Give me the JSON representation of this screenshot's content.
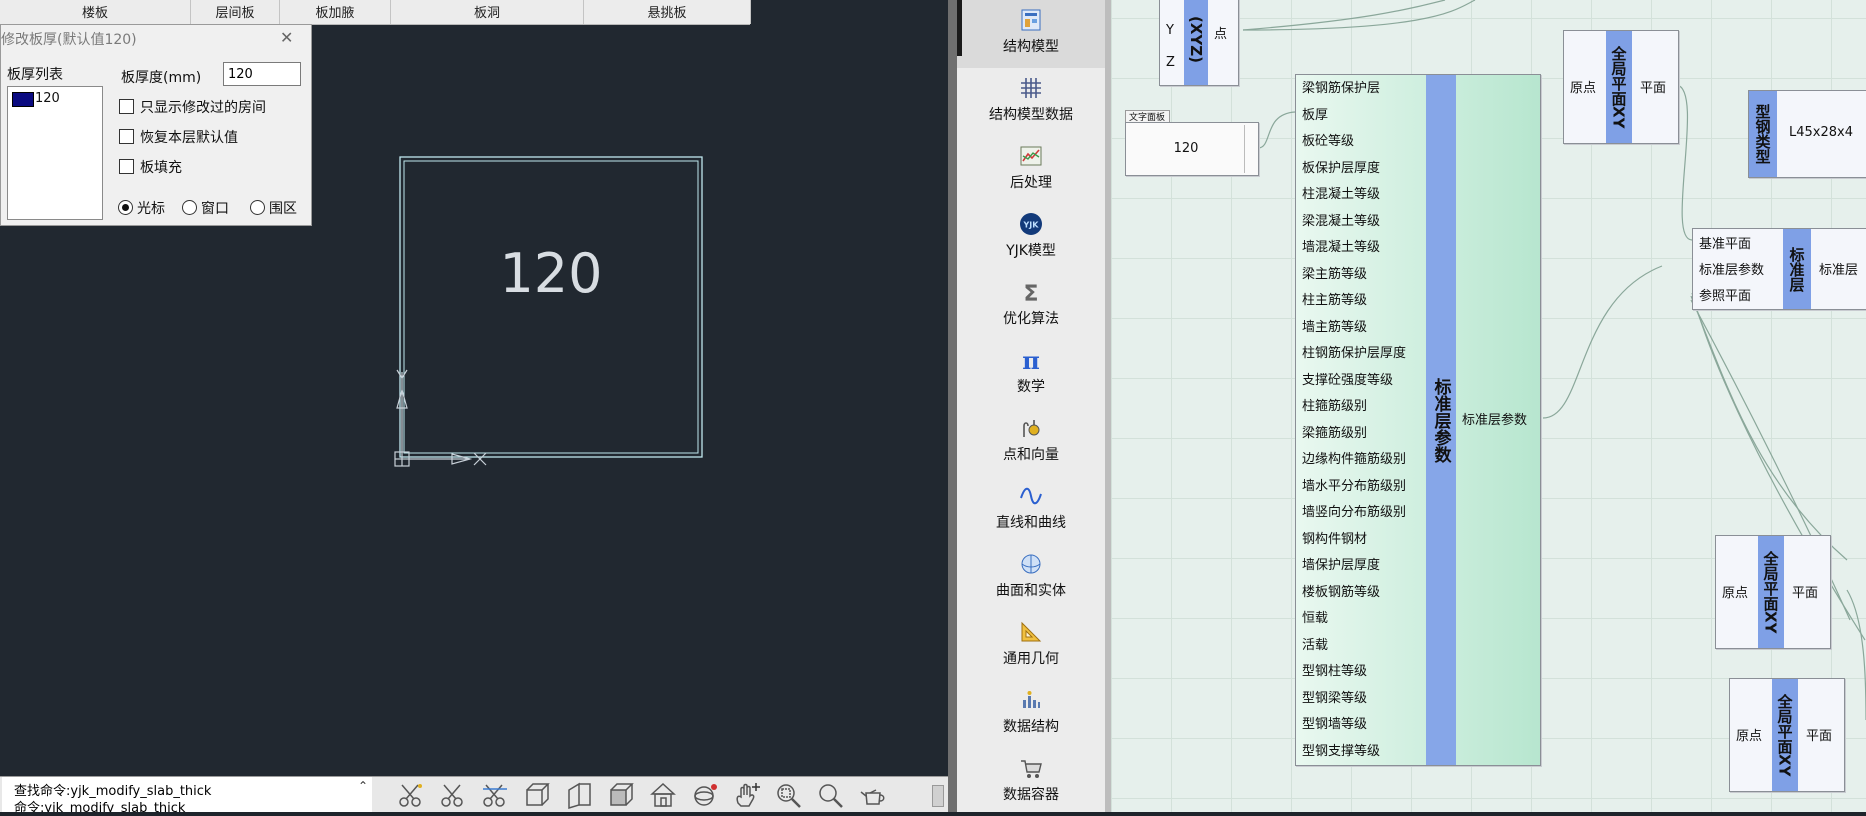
{
  "top_tabs": [
    "楼板",
    "层间板",
    "板加腋",
    "板洞",
    "悬挑板"
  ],
  "dialog": {
    "title": "修改板厚(默认值120)",
    "list_caption": "板厚列表",
    "list_items": [
      "120"
    ],
    "thickness_label": "板厚度(mm)",
    "thickness_value": "120",
    "checkboxes": [
      "只显示修改过的房间",
      "恢复本层默认值",
      "板填充"
    ],
    "radios": [
      "光标",
      "窗口",
      "围区"
    ],
    "radio_selected": "光标"
  },
  "drawing": {
    "slab_label": "120"
  },
  "command": {
    "lines": [
      "查找命令:yjk_modify_slab_thick",
      "命令:yjk_modify_slab_thick"
    ]
  },
  "menu": {
    "items": [
      {
        "label": "结构模型",
        "icon": "structure-model-icon",
        "active": true
      },
      {
        "label": "结构模型数据",
        "icon": "grid-data-icon"
      },
      {
        "label": "后处理",
        "icon": "chart-icon"
      },
      {
        "label": "YJK模型",
        "icon": "yjk-logo-icon"
      },
      {
        "label": "优化算法",
        "icon": "sigma-icon"
      },
      {
        "label": "数学",
        "icon": "pi-icon"
      },
      {
        "label": "点和向量",
        "icon": "point-vector-icon"
      },
      {
        "label": "直线和曲线",
        "icon": "curve-icon"
      },
      {
        "label": "曲面和实体",
        "icon": "surface-icon"
      },
      {
        "label": "通用几何",
        "icon": "triangle-ruler-icon"
      },
      {
        "label": "数据结构",
        "icon": "data-structure-icon"
      },
      {
        "label": "数据容器",
        "icon": "cart-icon"
      }
    ]
  },
  "nodes": {
    "xyz": {
      "title": "(XYZ)",
      "inputs": [
        "Y",
        "Z"
      ],
      "output": "点"
    },
    "text_panel": {
      "tag": "文字面板",
      "value": "120"
    },
    "std_params": {
      "title": "标准层参数",
      "inputs": [
        "梁钢筋保护层",
        "板厚",
        "板砼等级",
        "板保护层厚度",
        "柱混凝土等级",
        "梁混凝土等级",
        "墙混凝土等级",
        "梁主筋等级",
        "柱主筋等级",
        "墙主筋等级",
        "柱钢筋保护层厚度",
        "支撑砼强度等级",
        "柱箍筋级别",
        "梁箍筋级别",
        "边缘构件箍筋级别",
        "墙水平分布筋级别",
        "墙竖向分布筋级别",
        "钢构件钢材",
        "墙保护层厚度",
        "楼板钢筋等级",
        "恒载",
        "活载",
        "型钢柱等级",
        "型钢梁等级",
        "型钢墙等级",
        "型钢支撑等级"
      ],
      "output": "标准层参数"
    },
    "plane_xy_1": {
      "title": "全局平面XY",
      "input": "原点",
      "output": "平面"
    },
    "steel_type": {
      "title": "型钢类型",
      "value": "L45x28x4"
    },
    "std_layer": {
      "title": "标准层",
      "inputs": [
        "基准平面",
        "标准层参数",
        "参照平面"
      ],
      "output": "标准层"
    },
    "plane_xy_2": {
      "title": "全局平面XY",
      "input": "原点",
      "output": "平面"
    },
    "plane_xy_3": {
      "title": "全局平面XY",
      "input": "原点",
      "output": "平面"
    }
  },
  "colors": {
    "cad_bg": "#212830",
    "slab_outline": "#bfe8ee",
    "node_title": "#7fa0e6",
    "std_params_bg": "#c9eedd",
    "list_swatch": "#0a0a80"
  }
}
